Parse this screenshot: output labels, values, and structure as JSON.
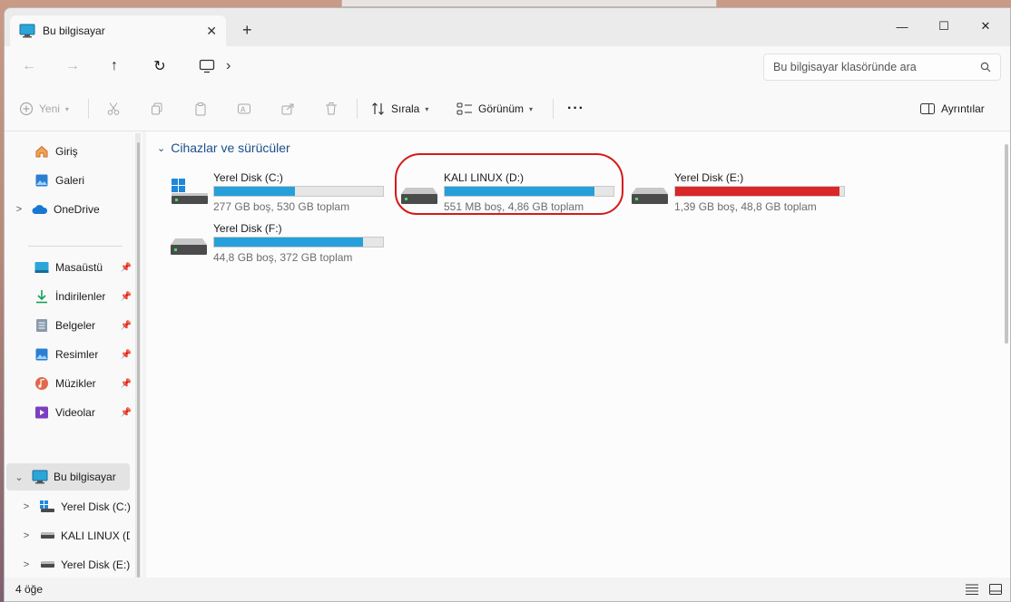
{
  "window": {
    "tab_title": "Bu bilgisayar",
    "new_tab": "+",
    "close_tab": "✕",
    "minimize": "—",
    "maximize": "☐",
    "close": "✕"
  },
  "nav": {
    "back": "←",
    "forward": "→",
    "up": "↑",
    "refresh": "↻",
    "breadcrumb_sep": "›"
  },
  "search": {
    "placeholder": "Bu bilgisayar klasöründe ara"
  },
  "toolbar": {
    "new_label": "Yeni",
    "sort_label": "Sırala",
    "view_label": "Görünüm",
    "more_label": "···",
    "details_label": "Ayrıntılar"
  },
  "sidebar": {
    "items": [
      {
        "label": "Giriş",
        "icon": "home-icon"
      },
      {
        "label": "Galeri",
        "icon": "gallery-icon"
      },
      {
        "label": "OneDrive",
        "icon": "cloud-icon"
      },
      {
        "label": "Masaüstü",
        "icon": "desktop-icon"
      },
      {
        "label": "İndirilenler",
        "icon": "download-icon"
      },
      {
        "label": "Belgeler",
        "icon": "documents-icon"
      },
      {
        "label": "Resimler",
        "icon": "pictures-icon"
      },
      {
        "label": "Müzikler",
        "icon": "music-icon"
      },
      {
        "label": "Videolar",
        "icon": "videos-icon"
      },
      {
        "label": "Bu bilgisayar",
        "icon": "computer-icon"
      },
      {
        "label": "Yerel Disk (C:)",
        "icon": "windows-drive-icon"
      },
      {
        "label": "KALI LINUX (D:",
        "icon": "drive-icon"
      },
      {
        "label": "Yerel Disk (E:)",
        "icon": "drive-icon"
      }
    ]
  },
  "main": {
    "section_title": "Cihazlar ve sürücüler",
    "drives": [
      {
        "name": "Yerel Disk (C:)",
        "info": "277 GB boş, 530 GB toplam",
        "used_fraction": 0.477,
        "color": "#26a0da",
        "icon": "windows-drive-icon"
      },
      {
        "name": "KALI LINUX (D:)",
        "info": "551 MB boş, 4,86 GB toplam",
        "used_fraction": 0.889,
        "color": "#26a0da",
        "icon": "drive-icon"
      },
      {
        "name": "Yerel Disk (E:)",
        "info": "1,39 GB boş, 48,8 GB toplam",
        "used_fraction": 0.972,
        "color": "#da2626",
        "icon": "drive-icon"
      },
      {
        "name": "Yerel Disk (F:)",
        "info": "44,8 GB boş, 372 GB toplam",
        "used_fraction": 0.88,
        "color": "#26a0da",
        "icon": "drive-icon"
      }
    ]
  },
  "status": {
    "item_count": "4 öğe"
  }
}
